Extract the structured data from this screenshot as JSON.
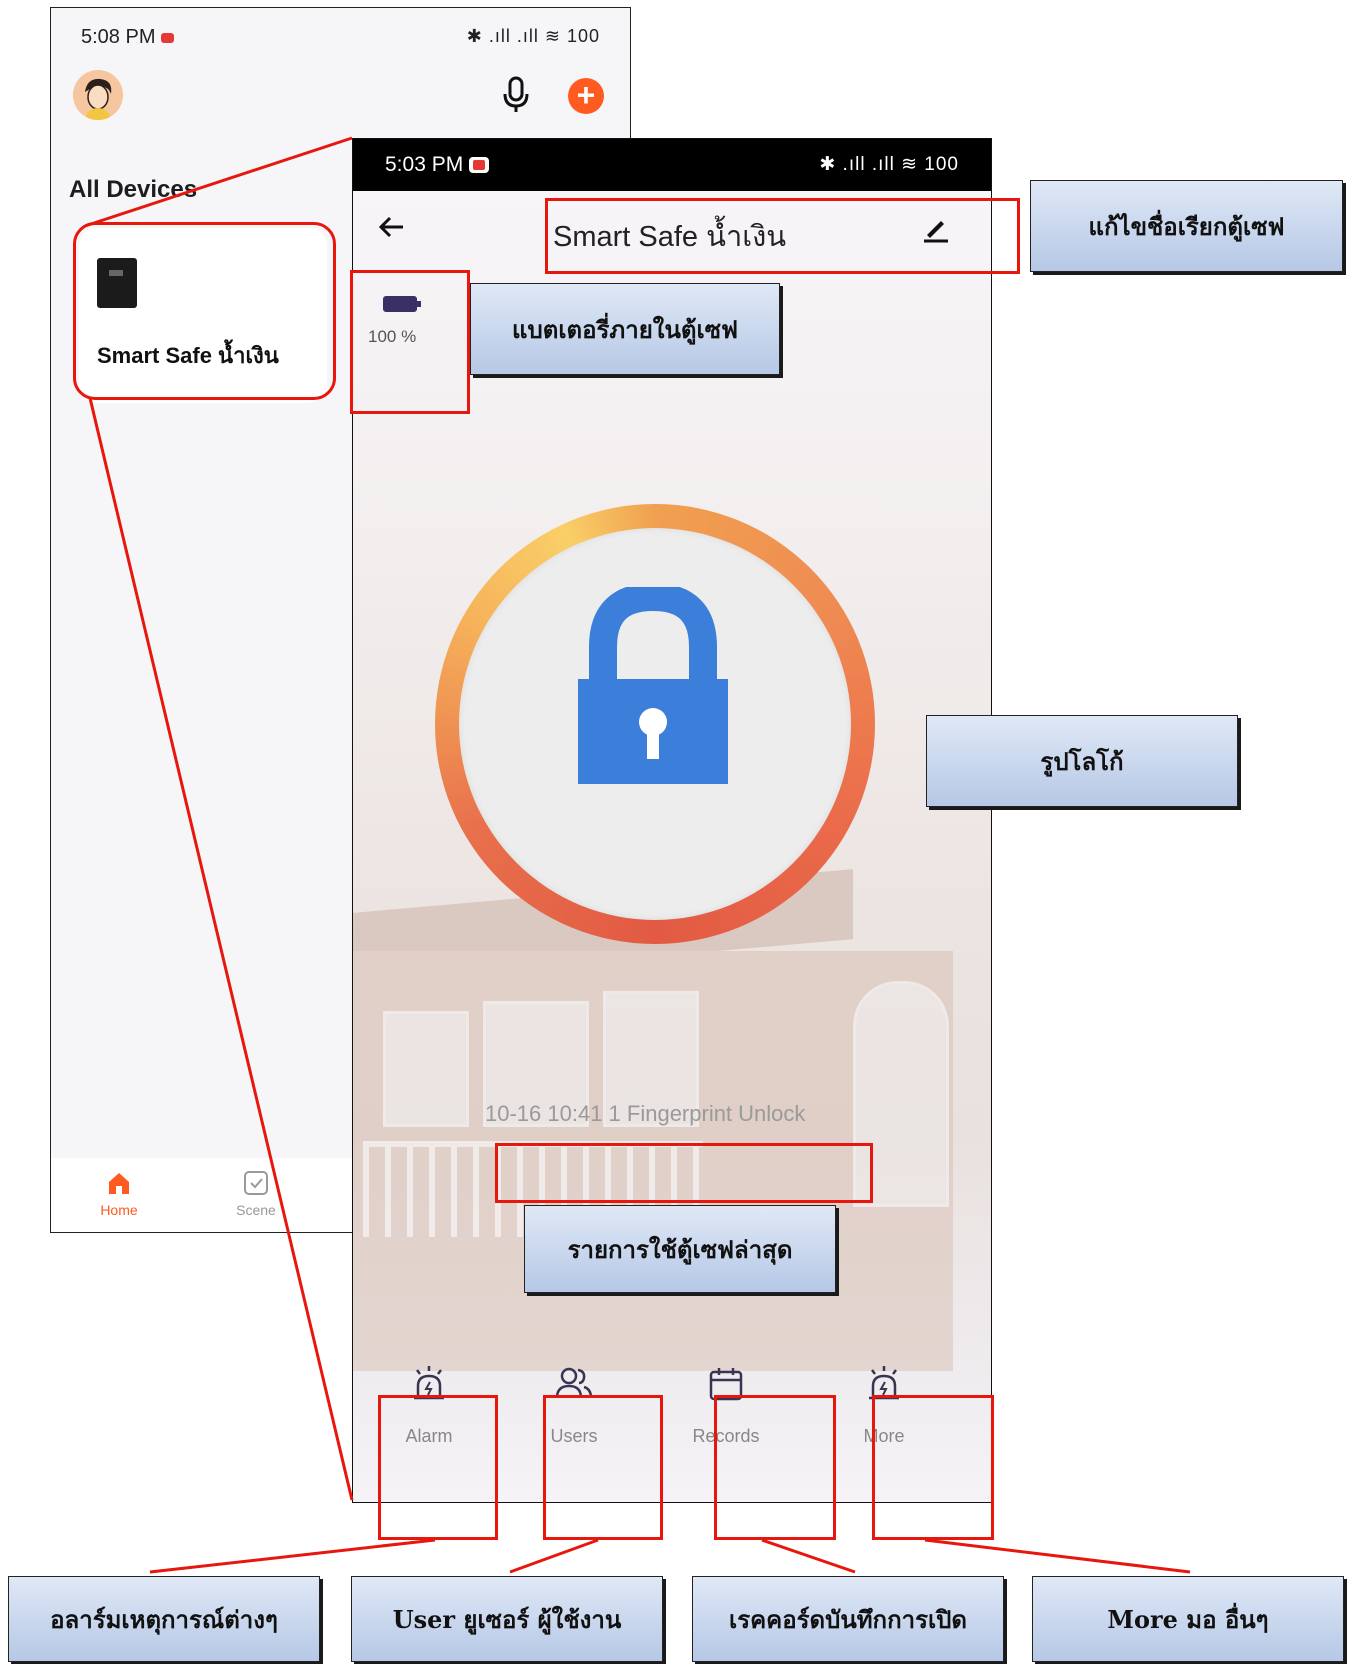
{
  "home_screen": {
    "status_time": "5:08 PM",
    "status_icons": "✱ .ıll .ıll ≋ 100",
    "title": "All Devices",
    "device_card": {
      "name": "Smart Safe น้ำเงิน"
    },
    "tabs": [
      {
        "label": "Home",
        "icon": "home-icon",
        "active": true
      },
      {
        "label": "Scene",
        "icon": "scene-icon",
        "active": false
      }
    ]
  },
  "device_screen": {
    "status_time": "5:03 PM",
    "status_icons": "✱ .ıll .ıll ≋ 100",
    "title": "Smart Safe น้ำเงิน",
    "battery_percent": "100 %",
    "lock_state_icon": "padlock-locked-icon",
    "last_record": "10-16 10:41  1 Fingerprint Unlock",
    "bottom_actions": [
      {
        "label": "Alarm",
        "icon": "alarm-icon"
      },
      {
        "label": "Users",
        "icon": "users-icon"
      },
      {
        "label": "Records",
        "icon": "calendar-icon"
      },
      {
        "label": "More",
        "icon": "alarm-icon"
      }
    ]
  },
  "callouts": {
    "rename": "แก้ไขชื่อเรียกตู้เซฟ",
    "battery": "แบตเตอรี่ภายในตู้เซฟ",
    "logo": "รูปโลโก้",
    "last_record": "รายการใช้ตู้เซฟล่าสุด",
    "alarm": "อลาร์มเหตุการณ์ต่างๆ",
    "users": "User ยูเซอร์ ผู้ใช้งาน",
    "records": "เรคคอร์ดบันทึกการเปิด",
    "more": "More มอ อื่นๆ"
  },
  "colors": {
    "annotation_red": "#e8170e",
    "accent_orange": "#ff5a1f",
    "lock_blue": "#3b7fdb",
    "callout_blue": "#b6c8e6"
  }
}
